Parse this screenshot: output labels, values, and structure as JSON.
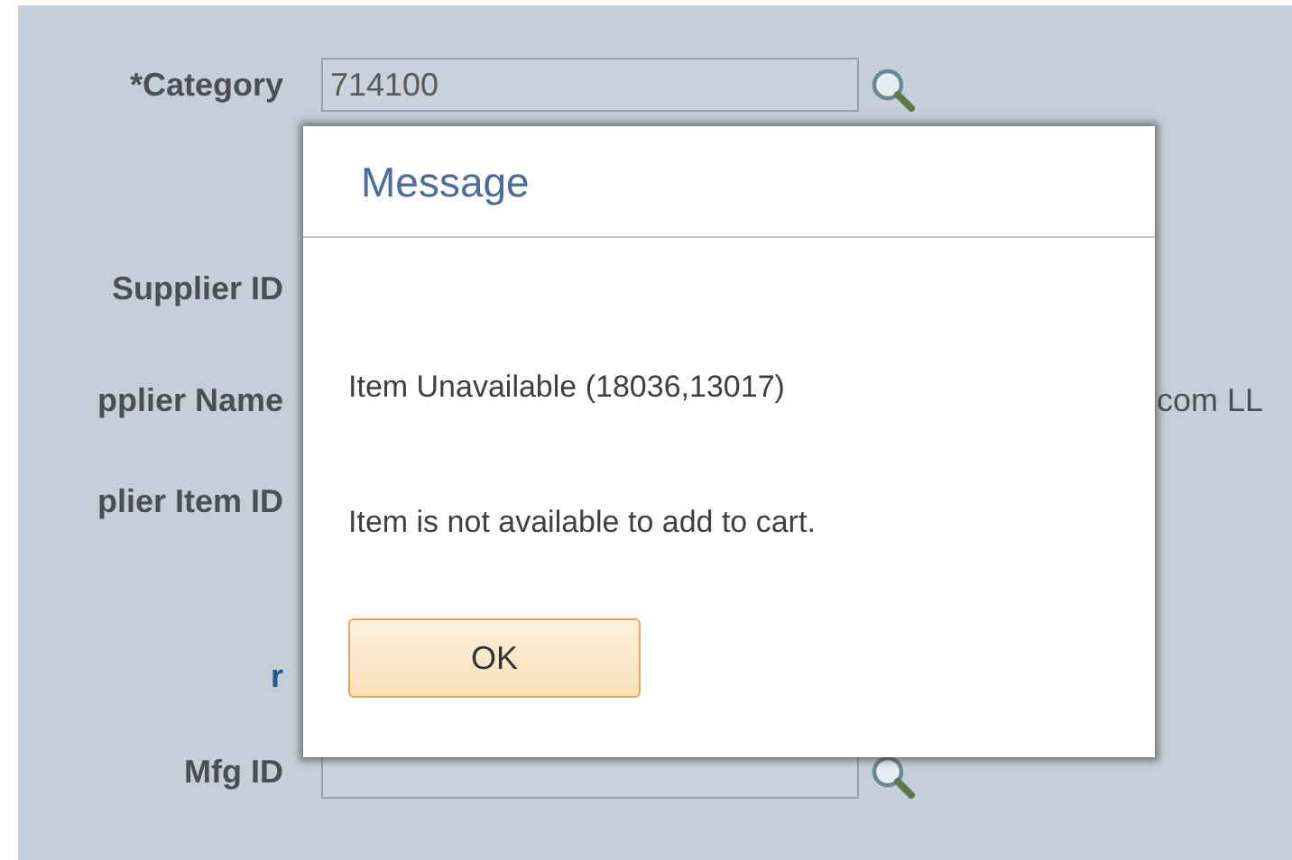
{
  "form": {
    "rows": [
      {
        "kind": "field",
        "label": "*Category",
        "value": "714100",
        "lookup": true
      },
      {
        "kind": "label",
        "label": "Supplier ID"
      },
      {
        "kind": "text",
        "label": "pplier Name",
        "value": "com LL"
      },
      {
        "kind": "label",
        "label": "plier Item ID"
      },
      {
        "kind": "heading",
        "label": "r"
      },
      {
        "kind": "field",
        "label": "Mfg ID",
        "value": "",
        "lookup": true
      }
    ]
  },
  "dialog": {
    "title": "Message",
    "lines": [
      "Item Unavailable (18036,13017)",
      "Item is not available to add to cart."
    ],
    "buttons": [
      "OK"
    ]
  }
}
